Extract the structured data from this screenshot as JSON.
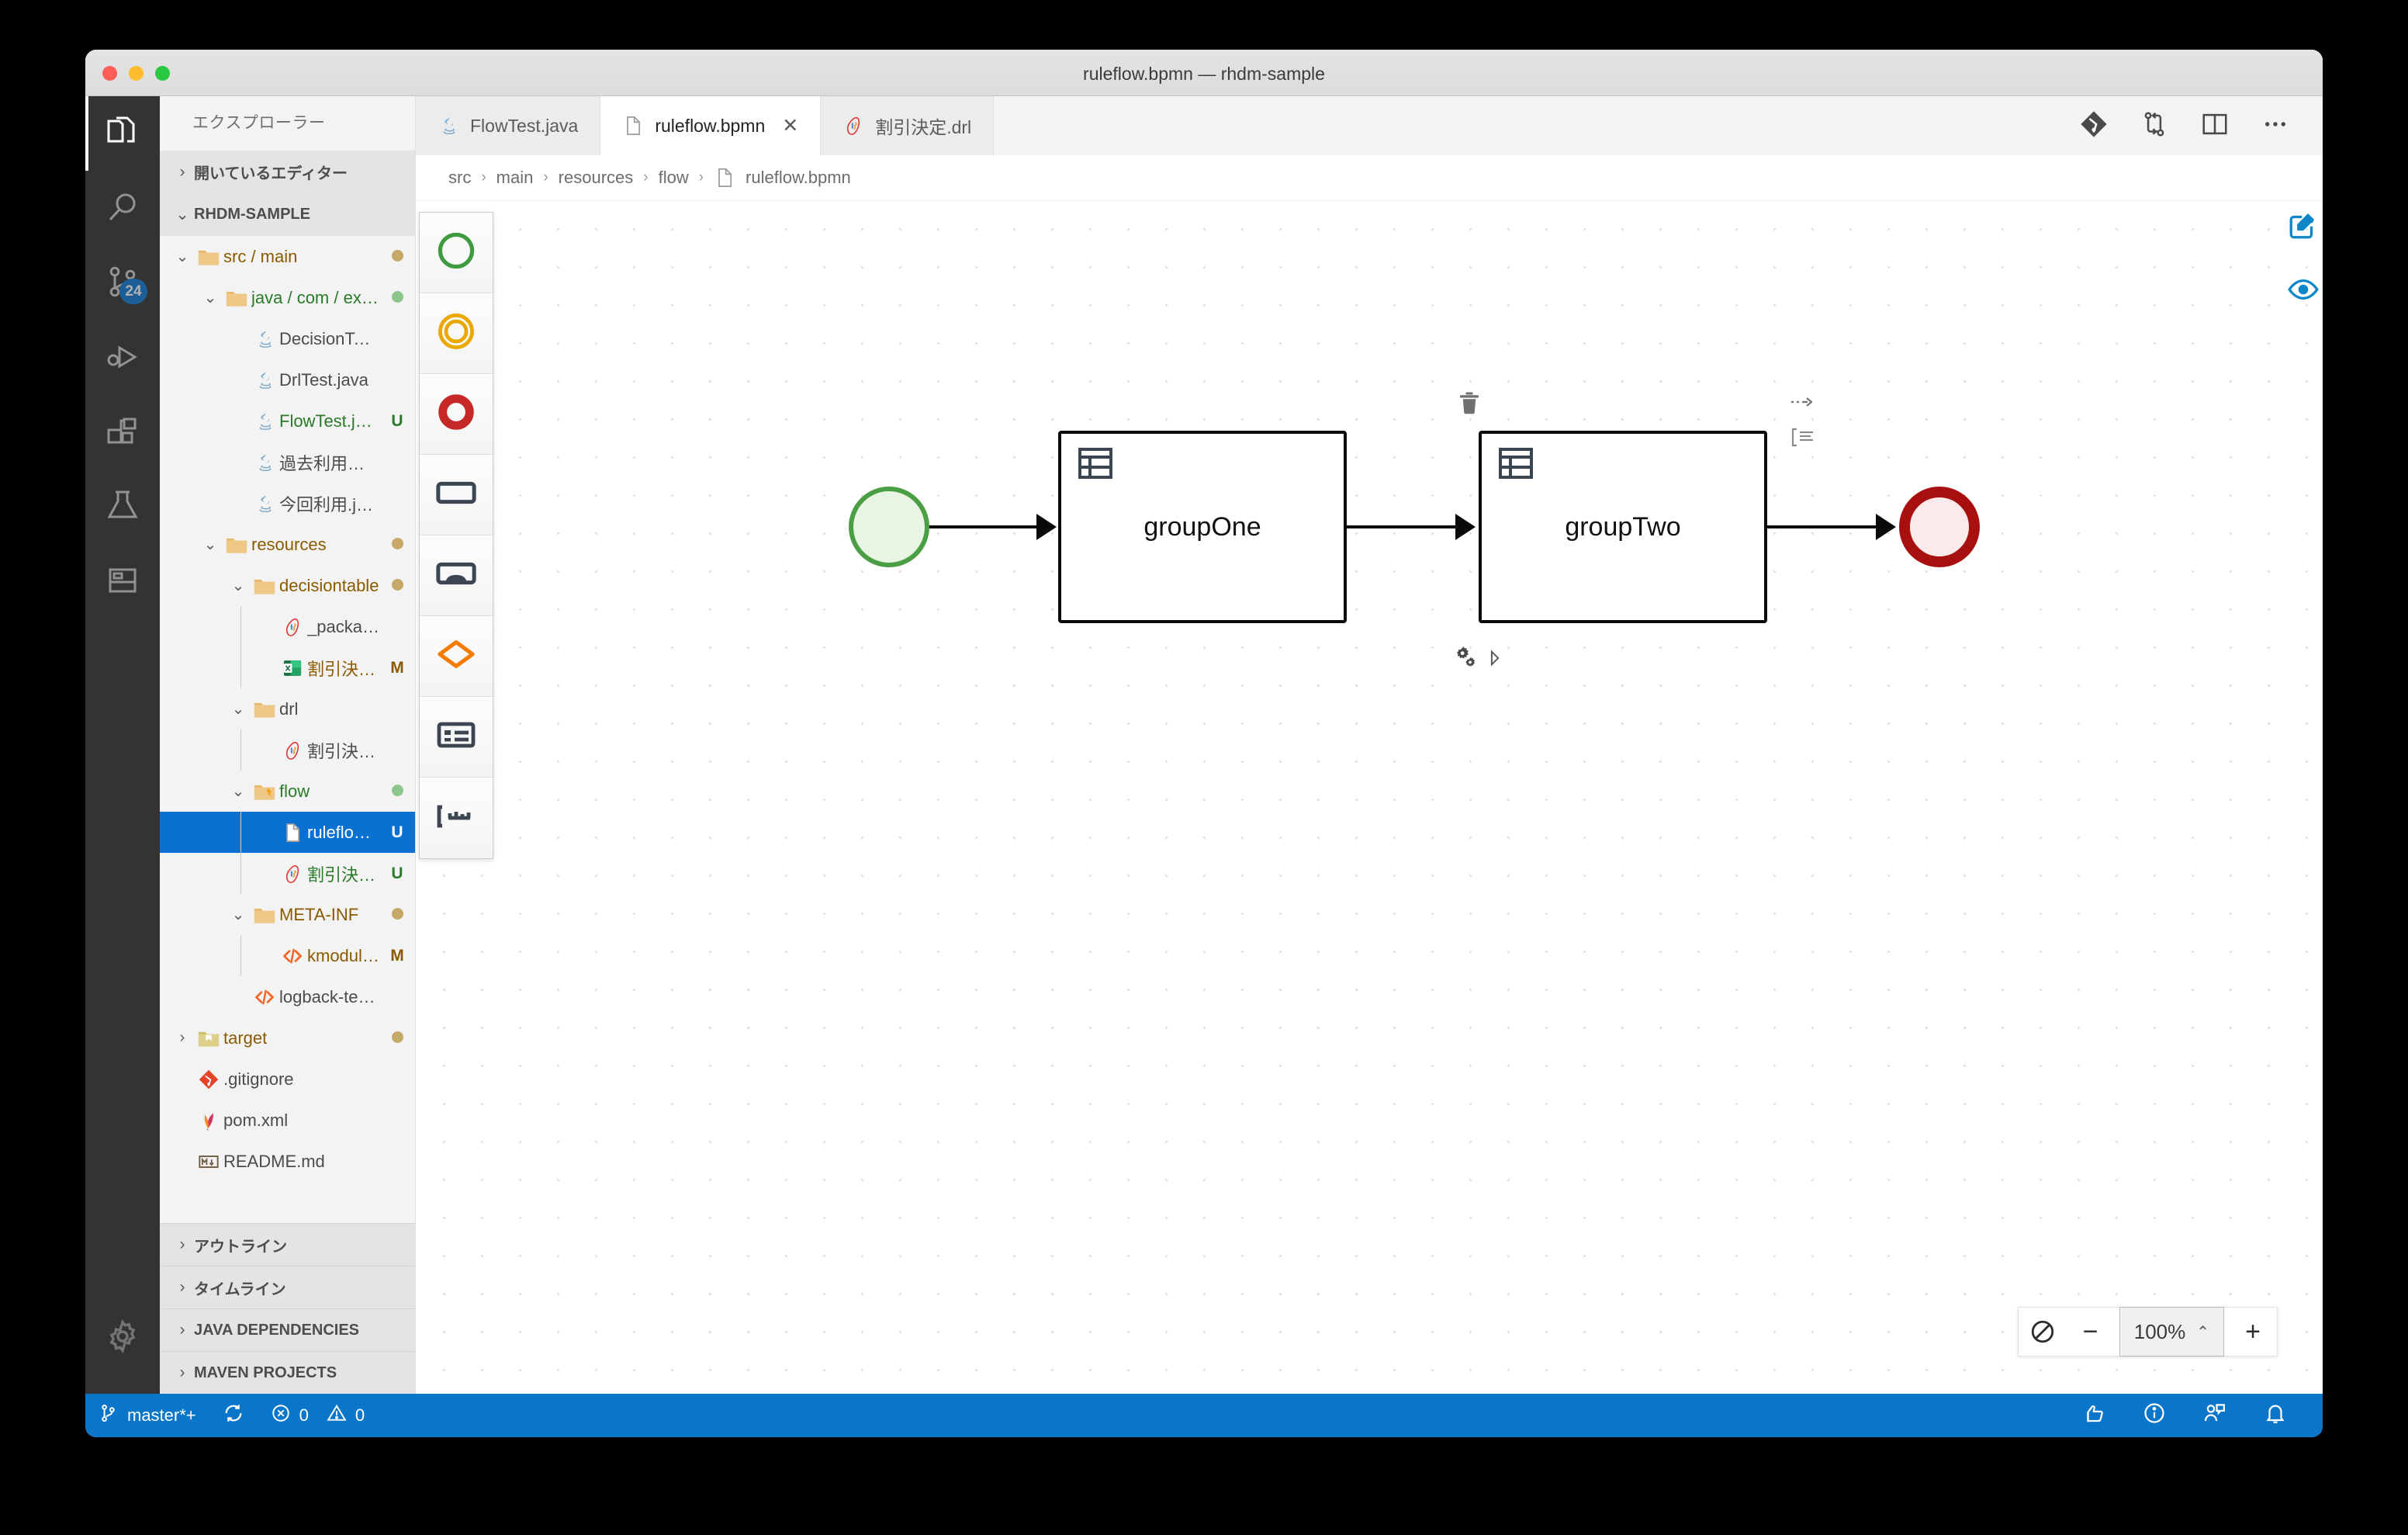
{
  "window": {
    "title": "ruleflow.bpmn — rhdm-sample",
    "traffic_lights": [
      "close",
      "minimize",
      "zoom"
    ]
  },
  "activitybar": {
    "items": [
      {
        "name": "explorer",
        "icon": "files-icon",
        "active": true,
        "badge": ""
      },
      {
        "name": "search",
        "icon": "search-icon",
        "active": false,
        "badge": ""
      },
      {
        "name": "source-control",
        "icon": "source-control-icon",
        "active": false,
        "badge": "24"
      },
      {
        "name": "run-and-debug",
        "icon": "run-debug-icon",
        "active": false,
        "badge": ""
      },
      {
        "name": "extensions",
        "icon": "extensions-icon",
        "active": false,
        "badge": ""
      },
      {
        "name": "testing",
        "icon": "beaker-icon",
        "active": false,
        "badge": ""
      },
      {
        "name": "database",
        "icon": "database-icon",
        "active": false,
        "badge": ""
      }
    ],
    "settings": {
      "name": "manage",
      "icon": "gear-icon"
    }
  },
  "sidebar": {
    "title": "エクスプローラー",
    "sections": [
      {
        "label": "開いているエディター",
        "expanded": false
      },
      {
        "label": "RHDM-SAMPLE",
        "expanded": true
      }
    ],
    "tree": [
      {
        "label": "src / main",
        "icon": "folder-icon",
        "kind": "folder",
        "indent": 1,
        "twisty": "down",
        "color": "orange",
        "deco": "",
        "deco_dot": "#c6a96a"
      },
      {
        "label": "java / com / example / rhdm",
        "icon": "folder-icon",
        "kind": "folder",
        "indent": 2,
        "twisty": "down",
        "color": "green",
        "deco": "",
        "deco_dot": "#8cc68c"
      },
      {
        "label": "DecisionTableTest.java",
        "icon": "java-icon",
        "kind": "file",
        "indent": 3,
        "twisty": "",
        "color": "gray",
        "deco": "",
        "deco_dot": ""
      },
      {
        "label": "DrlTest.java",
        "icon": "java-icon",
        "kind": "file",
        "indent": 3,
        "twisty": "",
        "color": "gray",
        "deco": "",
        "deco_dot": ""
      },
      {
        "label": "FlowTest.java",
        "icon": "java-icon",
        "kind": "file",
        "indent": 3,
        "twisty": "",
        "color": "green",
        "deco": "U",
        "deco_dot": ""
      },
      {
        "label": "過去利用状況.java",
        "icon": "java-icon",
        "kind": "file",
        "indent": 3,
        "twisty": "",
        "color": "gray",
        "deco": "",
        "deco_dot": ""
      },
      {
        "label": "今回利用.java",
        "icon": "java-icon",
        "kind": "file",
        "indent": 3,
        "twisty": "",
        "color": "gray",
        "deco": "",
        "deco_dot": ""
      },
      {
        "label": "resources",
        "icon": "folder-icon",
        "kind": "folder",
        "indent": 2,
        "twisty": "down",
        "color": "orange",
        "deco": "",
        "deco_dot": "#c6a96a"
      },
      {
        "label": "decisiontable",
        "icon": "folder-icon",
        "kind": "folder",
        "indent": 3,
        "twisty": "down",
        "color": "orange",
        "deco": "",
        "deco_dot": "#c6a96a"
      },
      {
        "label": "_package.drl",
        "icon": "drl-icon",
        "kind": "file",
        "indent": 4,
        "twisty": "",
        "color": "gray",
        "deco": "",
        "deco_dot": ""
      },
      {
        "label": "割引決定.xlsx",
        "icon": "excel-icon",
        "kind": "file",
        "indent": 4,
        "twisty": "",
        "color": "orange",
        "deco": "M",
        "deco_dot": ""
      },
      {
        "label": "drl",
        "icon": "folder-icon",
        "kind": "folder",
        "indent": 3,
        "twisty": "down",
        "color": "gray",
        "deco": "",
        "deco_dot": ""
      },
      {
        "label": "割引決定.drl",
        "icon": "drl-icon",
        "kind": "file",
        "indent": 4,
        "twisty": "",
        "color": "gray",
        "deco": "",
        "deco_dot": ""
      },
      {
        "label": "flow",
        "icon": "folder-open-icon",
        "kind": "folder",
        "indent": 3,
        "twisty": "down",
        "color": "green",
        "deco": "",
        "deco_dot": "#8cc68c"
      },
      {
        "label": "ruleflow.bpmn",
        "icon": "file-icon",
        "kind": "file",
        "indent": 4,
        "twisty": "",
        "color": "selected",
        "deco": "U",
        "deco_dot": "",
        "selected": true
      },
      {
        "label": "割引決定.drl",
        "icon": "drl-icon",
        "kind": "file",
        "indent": 4,
        "twisty": "",
        "color": "green",
        "deco": "U",
        "deco_dot": ""
      },
      {
        "label": "META-INF",
        "icon": "folder-icon",
        "kind": "folder",
        "indent": 3,
        "twisty": "down",
        "color": "orange",
        "deco": "",
        "deco_dot": "#c6a96a"
      },
      {
        "label": "kmodule.xml",
        "icon": "xml-icon",
        "kind": "file",
        "indent": 4,
        "twisty": "",
        "color": "orange",
        "deco": "M",
        "deco_dot": ""
      },
      {
        "label": "logback-test.xml",
        "icon": "xml-icon",
        "kind": "file",
        "indent": 3,
        "twisty": "",
        "color": "gray",
        "deco": "",
        "deco_dot": ""
      },
      {
        "label": "target",
        "icon": "folder-target-icon",
        "kind": "folder",
        "indent": 1,
        "twisty": "right",
        "color": "orange",
        "deco": "",
        "deco_dot": "#c6a96a"
      },
      {
        "label": ".gitignore",
        "icon": "git-icon",
        "kind": "file",
        "indent": 1,
        "twisty": "",
        "color": "gray",
        "deco": "",
        "deco_dot": ""
      },
      {
        "label": "pom.xml",
        "icon": "maven-icon",
        "kind": "file",
        "indent": 1,
        "twisty": "",
        "color": "gray",
        "deco": "",
        "deco_dot": ""
      },
      {
        "label": "README.md",
        "icon": "markdown-icon",
        "kind": "file",
        "indent": 1,
        "twisty": "",
        "color": "gray",
        "deco": "",
        "deco_dot": ""
      }
    ],
    "panels": [
      {
        "label": "アウトライン",
        "expanded": false
      },
      {
        "label": "タイムライン",
        "expanded": false
      },
      {
        "label": "JAVA DEPENDENCIES",
        "expanded": false
      },
      {
        "label": "MAVEN PROJECTS",
        "expanded": false
      }
    ]
  },
  "tabs": [
    {
      "label": "FlowTest.java",
      "icon": "java-icon",
      "active": false,
      "closable": false
    },
    {
      "label": "ruleflow.bpmn",
      "icon": "file-icon",
      "active": true,
      "closable": true,
      "close_label": "✕"
    },
    {
      "label": "割引決定.drl",
      "icon": "drl-icon",
      "active": false,
      "closable": false
    }
  ],
  "tabbar_actions": [
    {
      "name": "git-graph",
      "icon": "git-diamond-icon"
    },
    {
      "name": "compare-changes",
      "icon": "compare-icon"
    },
    {
      "name": "split-editor",
      "icon": "split-editor-icon"
    },
    {
      "name": "more-actions",
      "icon": "ellipsis-icon"
    }
  ],
  "breadcrumb": [
    "src",
    "main",
    "resources",
    "flow",
    "ruleflow.bpmn"
  ],
  "breadcrumb_separator": "›",
  "palette": [
    {
      "name": "start-event",
      "icon": "start-event-icon",
      "color": "#3f9b3f"
    },
    {
      "name": "intermediate-event",
      "icon": "intermediate-event-icon",
      "color": "#eaa800"
    },
    {
      "name": "end-event",
      "icon": "end-event-icon",
      "color": "#c62828"
    },
    {
      "name": "task",
      "icon": "task-icon",
      "color": "#3c4652"
    },
    {
      "name": "subprocess",
      "icon": "subprocess-icon",
      "color": "#3c4652"
    },
    {
      "name": "gateway",
      "icon": "gateway-icon",
      "color": "#f57c00"
    },
    {
      "name": "data-object",
      "icon": "data-object-icon",
      "color": "#3c4652"
    },
    {
      "name": "lane",
      "icon": "lane-icon",
      "color": "#3c4652"
    }
  ],
  "canvas_right_icons": [
    {
      "name": "edit-properties",
      "icon": "pencil-square-icon",
      "color": "#0e87c9"
    },
    {
      "name": "preview",
      "icon": "eye-icon",
      "color": "#0e87c9"
    }
  ],
  "diagram": {
    "nodes": [
      {
        "id": "start",
        "type": "start-event",
        "label": ""
      },
      {
        "id": "groupOne",
        "type": "business-rule-task",
        "label": "groupOne"
      },
      {
        "id": "groupTwo",
        "type": "business-rule-task",
        "label": "groupTwo",
        "selected": true
      },
      {
        "id": "end",
        "type": "end-event",
        "label": ""
      }
    ],
    "context_icons": [
      {
        "name": "delete",
        "icon": "trash-icon"
      },
      {
        "name": "sequence-flow",
        "icon": "dashed-arrow-icon"
      },
      {
        "name": "text-annotation",
        "icon": "annotation-icon"
      },
      {
        "name": "morph-node",
        "icon": "gears-icon"
      },
      {
        "name": "expand-options",
        "icon": "caret-right-icon"
      }
    ]
  },
  "zoom_control": {
    "reset_label": "⊘",
    "minus_label": "−",
    "value": "100%",
    "caret": "⌃",
    "plus_label": "+"
  },
  "statusbar": {
    "branch": "master*+",
    "sync_icon": "sync-icon",
    "errors": "0",
    "warnings": "0",
    "right_icons": [
      {
        "name": "feedback",
        "icon": "thumbsup-icon"
      },
      {
        "name": "info",
        "icon": "info-icon"
      },
      {
        "name": "live-share",
        "icon": "live-share-icon"
      },
      {
        "name": "notifications",
        "icon": "bell-icon"
      }
    ]
  },
  "colors": {
    "accent_blue": "#0a76c9",
    "selection_blue": "#0a70d1",
    "start_green": "#4a9e43",
    "end_red": "#a81010",
    "folder_orange": "#8a5a00",
    "git_green": "#2a7a2a"
  }
}
